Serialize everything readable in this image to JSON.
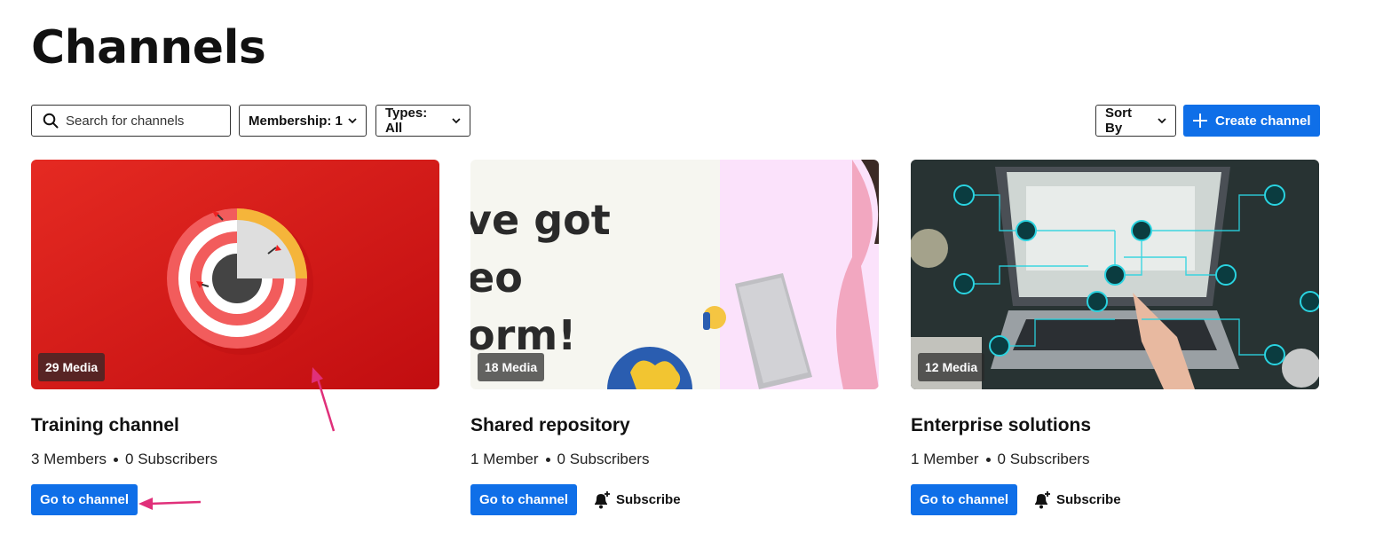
{
  "page": {
    "title": "Channels"
  },
  "toolbar": {
    "search_placeholder": "Search for channels",
    "membership_label": "Membership: 1",
    "types_label": "Types: All",
    "sort_label": "Sort By",
    "create_label": "Create channel"
  },
  "channels": [
    {
      "media_badge": "29 Media",
      "title": "Training channel",
      "members": "3 Members",
      "subscribers": "0 Subscribers",
      "go_label": "Go to channel"
    },
    {
      "media_badge": "18 Media",
      "title": "Shared repository",
      "members": "1 Member",
      "subscribers": "0 Subscribers",
      "go_label": "Go to channel",
      "subscribe_label": "Subscribe",
      "thumb_text": [
        "ve got",
        "eo",
        "orm!"
      ]
    },
    {
      "media_badge": "12 Media",
      "title": "Enterprise solutions",
      "members": "1 Member",
      "subscribers": "0 Subscribers",
      "go_label": "Go to channel",
      "subscribe_label": "Subscribe"
    }
  ],
  "icons": {
    "search": "search-icon",
    "chevron": "chevron-down-icon",
    "plus": "plus-icon",
    "bell": "bell-plus-icon"
  },
  "colors": {
    "primary": "#0f6fe8",
    "annotation": "#e0307a",
    "card1_bg": "#d7191c"
  }
}
